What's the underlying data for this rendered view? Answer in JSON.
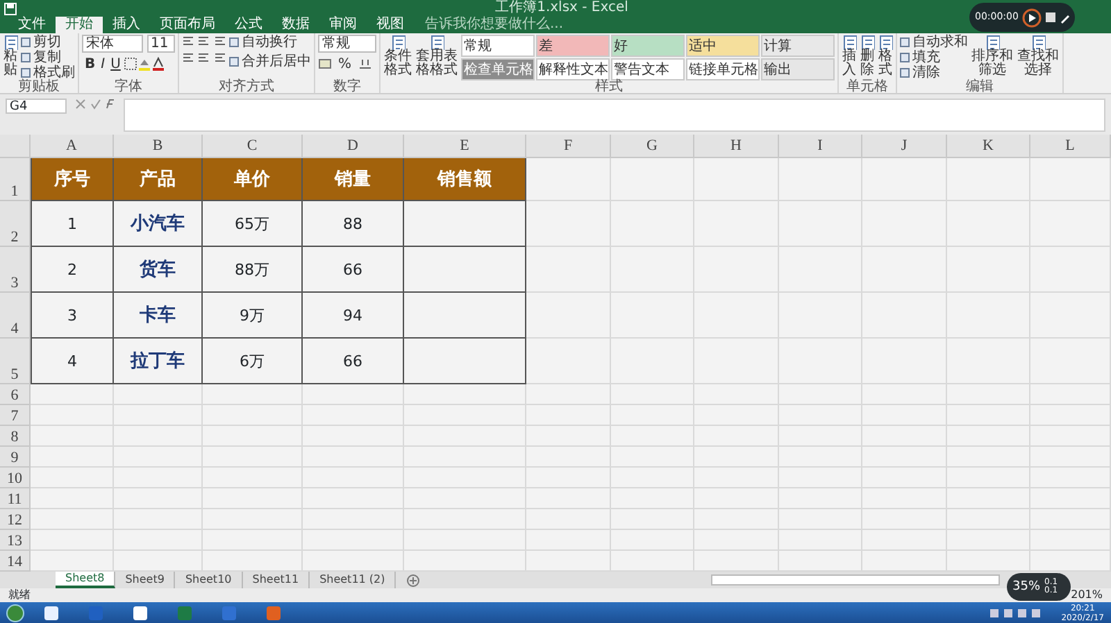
{
  "window": {
    "title": "工作簿1.xlsx - Excel"
  },
  "ribbon": {
    "tabs": [
      {
        "label": "文件",
        "selected": false
      },
      {
        "label": "开始",
        "selected": true
      },
      {
        "label": "插入",
        "selected": false
      },
      {
        "label": "页面布局",
        "selected": false
      },
      {
        "label": "公式",
        "selected": false
      },
      {
        "label": "数据",
        "selected": false
      },
      {
        "label": "审阅",
        "selected": false
      },
      {
        "label": "视图",
        "selected": false
      }
    ],
    "search": {
      "placeholder": "告诉我你想要做什么..."
    },
    "groups": [
      {
        "label": "剪贴板",
        "controls": [
          {
            "kind": "big",
            "label": "粘贴"
          },
          {
            "kind": "stack",
            "items": [
              "剪切",
              "复制",
              "格式刷"
            ]
          }
        ]
      },
      {
        "label": "字体",
        "controls": [
          {
            "kind": "fontrow",
            "font": "宋体",
            "size": "11",
            "formats": [
              "B",
              "I",
              "U"
            ]
          }
        ]
      },
      {
        "label": "对齐方式",
        "controls": [
          {
            "kind": "align",
            "items": [
              "自动换行",
              "合并后居中"
            ]
          }
        ]
      },
      {
        "label": "数字",
        "controls": [
          {
            "kind": "numfmt",
            "value": "常规",
            "formats": [
              "%"
            ]
          }
        ]
      },
      {
        "label": "样式",
        "controls": [
          {
            "kind": "big",
            "label": "条件格式"
          },
          {
            "kind": "big",
            "label": "套用表格格式"
          },
          {
            "kind": "gallery",
            "items": [
              {
                "label": "常规",
                "color": "#ffffff"
              },
              {
                "label": "差",
                "color": "#f2b8b8"
              },
              {
                "label": "好",
                "color": "#b7dfc3"
              },
              {
                "label": "适中",
                "color": "#f5df9c"
              },
              {
                "label": "计算",
                "color": "#e8e8e8"
              },
              {
                "label": "检查单元格",
                "color": "#8c8c8c"
              },
              {
                "label": "解释性文本",
                "color": "#ffffff"
              },
              {
                "label": "警告文本",
                "color": "#ffffff"
              },
              {
                "label": "链接单元格",
                "color": "#ffffff"
              },
              {
                "label": "输出",
                "color": "#e6e6e6"
              }
            ]
          }
        ]
      },
      {
        "label": "单元格",
        "controls": [
          {
            "kind": "big",
            "label": "插入"
          },
          {
            "kind": "big",
            "label": "删除"
          },
          {
            "kind": "big",
            "label": "格式"
          }
        ]
      },
      {
        "label": "编辑",
        "controls": [
          {
            "kind": "stack",
            "items": [
              "自动求和",
              "填充",
              "清除"
            ]
          },
          {
            "kind": "big",
            "label": "排序和筛选"
          },
          {
            "kind": "big",
            "label": "查找和选择"
          }
        ]
      }
    ]
  },
  "formula_bar": {
    "name_box": "G4"
  },
  "sheet": {
    "columns": [
      "A",
      "B",
      "C",
      "D",
      "E",
      "F",
      "G",
      "H",
      "I",
      "J",
      "K",
      "L"
    ],
    "rows": [
      {
        "number": "1",
        "kind": "header",
        "cells": [
          "序号",
          "产品",
          "单价",
          "销量",
          "销售额"
        ]
      },
      {
        "number": "2",
        "kind": "data",
        "cells": [
          "1",
          "小汽车",
          "65万",
          "88"
        ]
      },
      {
        "number": "3",
        "kind": "data",
        "cells": [
          "2",
          "货车",
          "88万",
          "66"
        ]
      },
      {
        "number": "4",
        "kind": "data",
        "cells": [
          "3",
          "卡车",
          "9万",
          "94"
        ]
      },
      {
        "number": "5",
        "kind": "data",
        "cells": [
          "4",
          "拉丁车",
          "6万",
          "66"
        ]
      },
      {
        "number": "6",
        "kind": "empty"
      },
      {
        "number": "7",
        "kind": "empty"
      },
      {
        "number": "8",
        "kind": "empty"
      },
      {
        "number": "9",
        "kind": "empty"
      },
      {
        "number": "10",
        "kind": "empty"
      },
      {
        "number": "11",
        "kind": "empty"
      },
      {
        "number": "12",
        "kind": "empty"
      },
      {
        "number": "13",
        "kind": "empty"
      },
      {
        "number": "14",
        "kind": "empty"
      }
    ]
  },
  "sheet_tabs": [
    {
      "label": "Sheet8",
      "selected": true
    },
    {
      "label": "Sheet9",
      "selected": false
    },
    {
      "label": "Sheet10",
      "selected": false
    },
    {
      "label": "Sheet11",
      "selected": false
    },
    {
      "label": "Sheet11 (2)",
      "selected": false
    }
  ],
  "status_bar": {
    "status": "就绪",
    "zoom": "201%"
  },
  "recorder": {
    "time": "00:00:00"
  },
  "monitor": {
    "percent": "35%",
    "upload": "0.1",
    "download": "0.1"
  },
  "taskbar": {
    "time": "20:21",
    "date": "2020/2/17"
  }
}
